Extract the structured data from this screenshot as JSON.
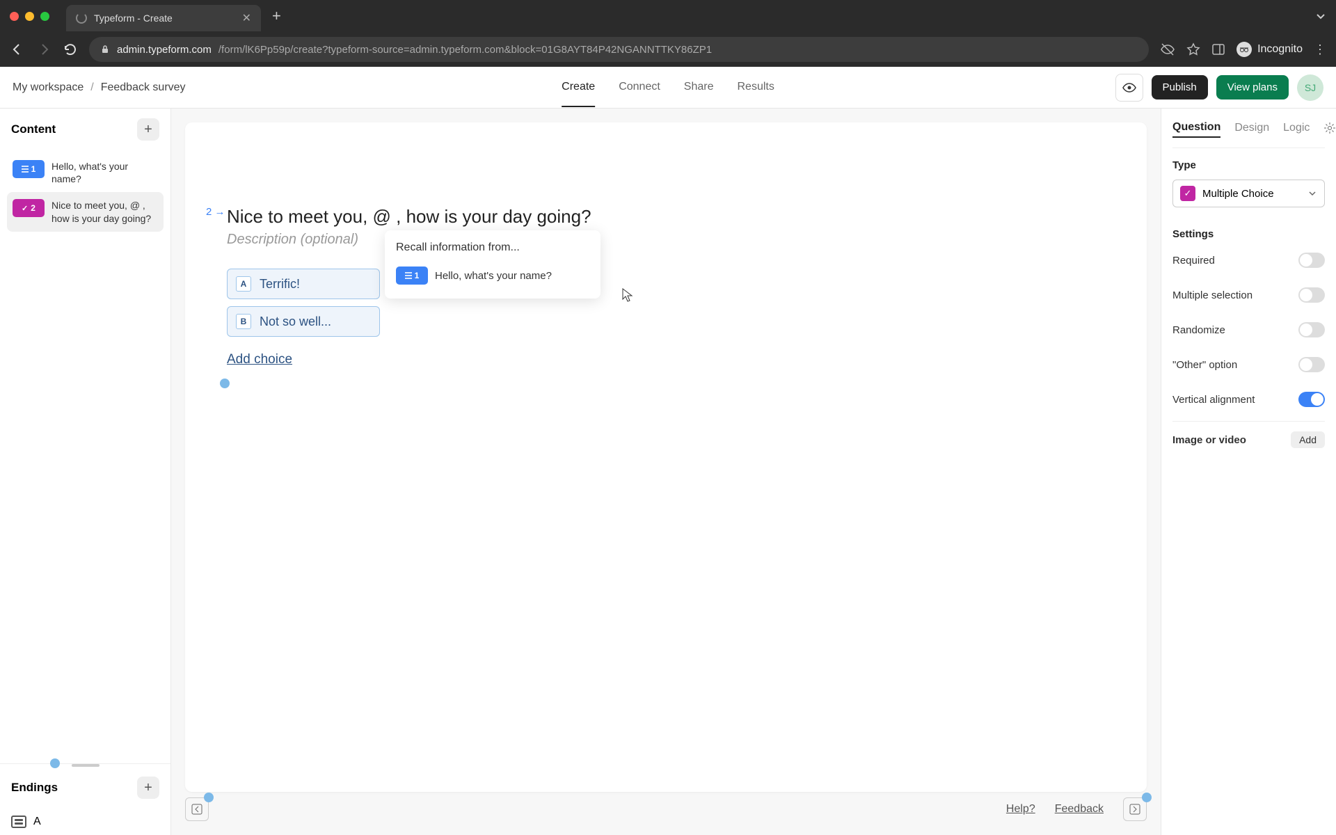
{
  "browser": {
    "tab_title": "Typeform - Create",
    "url_host": "admin.typeform.com",
    "url_path": "/form/lK6Pp59p/create?typeform-source=admin.typeform.com&block=01G8AYT84P42NGANNTTKY86ZP1",
    "incognito_label": "Incognito"
  },
  "header": {
    "workspace": "My workspace",
    "form_name": "Feedback survey",
    "tabs": {
      "create": "Create",
      "connect": "Connect",
      "share": "Share",
      "results": "Results"
    },
    "publish": "Publish",
    "view_plans": "View plans",
    "avatar": "SJ"
  },
  "left": {
    "content_title": "Content",
    "questions": [
      {
        "num": "1",
        "badge_color": "blue",
        "text": "Hello, what's your name?"
      },
      {
        "num": "2",
        "badge_color": "pink",
        "text": "Nice to meet you, @ , how is your day going?"
      }
    ],
    "endings_title": "Endings",
    "ending_label": "A"
  },
  "canvas": {
    "q_num": "2",
    "title": "Nice to meet you, @  , how is your day going?",
    "desc_placeholder": "Description (optional)",
    "choices": [
      {
        "key": "A",
        "label": "Terrific!"
      },
      {
        "key": "B",
        "label": "Not so well..."
      }
    ],
    "add_choice": "Add choice",
    "recall_title": "Recall information from...",
    "recall_item_num": "1",
    "recall_item_text": "Hello, what's your name?",
    "footer_help": "Help?",
    "footer_feedback": "Feedback"
  },
  "right": {
    "tabs": {
      "question": "Question",
      "design": "Design",
      "logic": "Logic"
    },
    "type_label": "Type",
    "type_value": "Multiple Choice",
    "settings_label": "Settings",
    "settings": {
      "required": "Required",
      "multiple": "Multiple selection",
      "randomize": "Randomize",
      "other": "\"Other\" option",
      "vertical": "Vertical alignment"
    },
    "image_label": "Image or video",
    "add": "Add"
  }
}
